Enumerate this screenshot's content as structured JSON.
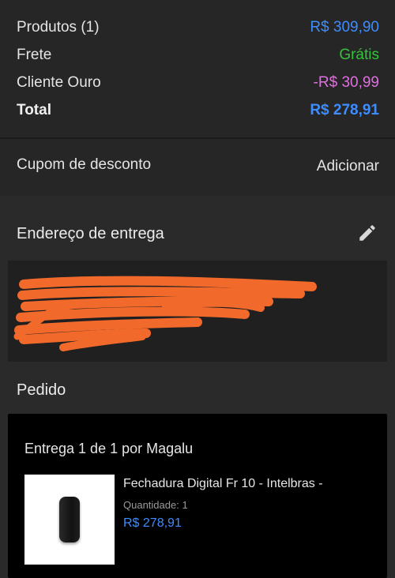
{
  "summary": {
    "products_label": "Produtos (1)",
    "products_value": "R$ 309,90",
    "shipping_label": "Frete",
    "shipping_value": "Grátis",
    "discount_label": "Cliente Ouro",
    "discount_value": "-R$ 30,99",
    "total_label": "Total",
    "total_value": "R$ 278,91"
  },
  "colors": {
    "blue": "#3d8dff",
    "green": "#35c23c",
    "pink": "#e06fe0",
    "redaction": "#f26a2b"
  },
  "coupon": {
    "label": "Cupom de desconto",
    "action": "Adicionar"
  },
  "address": {
    "heading": "Endereço de entrega",
    "edit_icon": "pencil-icon"
  },
  "order": {
    "heading": "Pedido",
    "delivery": "Entrega 1 de 1 por Magalu",
    "product_name": "Fechadura Digital Fr 10 - Intelbras -",
    "quantity": "Quantidade:  1",
    "price": "R$ 278,91"
  }
}
